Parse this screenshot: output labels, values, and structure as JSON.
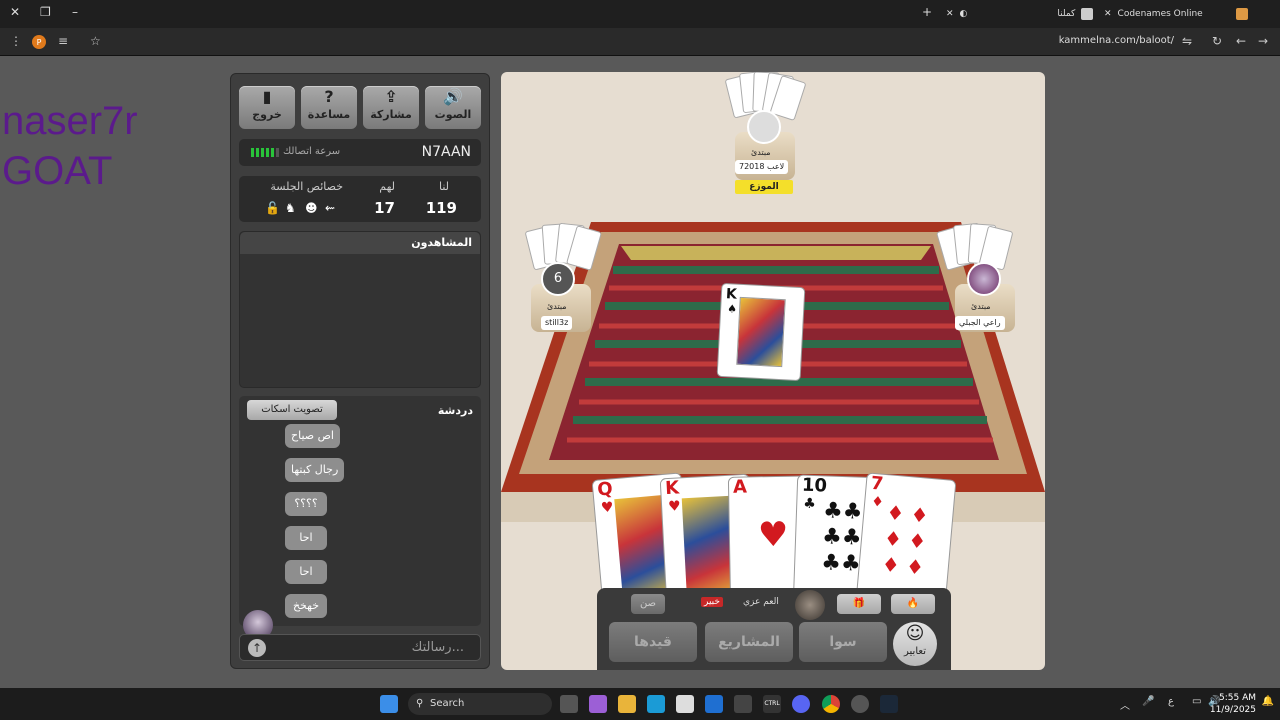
{
  "browser": {
    "tabs": [
      {
        "title": "Codenames Online"
      },
      {
        "title": "كملنا"
      }
    ],
    "url": "kammelna.com/baloot/",
    "profile_letter": "P"
  },
  "overlay": {
    "line1": "naser7r",
    "line2": "GOAT"
  },
  "panel": {
    "buttons": [
      {
        "label": "خروج",
        "icon": "▮"
      },
      {
        "label": "مساعدة",
        "icon": "?"
      },
      {
        "label": "مشاركة",
        "icon": "⇪"
      },
      {
        "label": "الصوت",
        "icon": "🔊"
      }
    ],
    "connection": {
      "label": "سرعة اتصالك",
      "username": "N7AAN"
    },
    "scores": {
      "us_label": "لنا",
      "them_label": "لهم",
      "session_label": "خصائص الجلسة",
      "us": "119",
      "them": "17"
    },
    "spectators_title": "المشاهدون",
    "chat": {
      "title": "دردشة",
      "mute_label": "تصويت اسكات",
      "messages": [
        "اص صياح",
        "رجال كبتها",
        "؟؟؟؟",
        "احا",
        "احا",
        "خهخخ"
      ],
      "placeholder": "رسالتك..."
    }
  },
  "game": {
    "players": {
      "top": {
        "name": "لاعب 72018",
        "title": "مبتدئ",
        "dealer_label": "الموزع"
      },
      "left": {
        "name": "still3z",
        "title": "مبتدئ",
        "badge": "6"
      },
      "right": {
        "name": "راعي الجبلي",
        "title": "مبتدئ"
      }
    },
    "center_card": {
      "rank": "K",
      "suit": "♠"
    },
    "hand": [
      {
        "rank": "Q",
        "suit": "♥",
        "color": "#d2191f"
      },
      {
        "rank": "K",
        "suit": "♥",
        "color": "#d2191f"
      },
      {
        "rank": "A",
        "suit": "♥",
        "color": "#d2191f"
      },
      {
        "rank": "10",
        "suit": "♣",
        "color": "#111111"
      },
      {
        "rank": "7",
        "suit": "♦",
        "color": "#d2191f"
      }
    ],
    "controls": {
      "sun_btn": "صن",
      "tag": "خبير",
      "self_name": "العم عزي",
      "big_buttons": [
        "قيدها",
        "المشاريع",
        "سوا"
      ],
      "expressions": "تعابير"
    }
  },
  "taskbar": {
    "search_placeholder": "Search",
    "time": "5:55 AM",
    "date": "11/9/2025",
    "lang": "ع"
  }
}
